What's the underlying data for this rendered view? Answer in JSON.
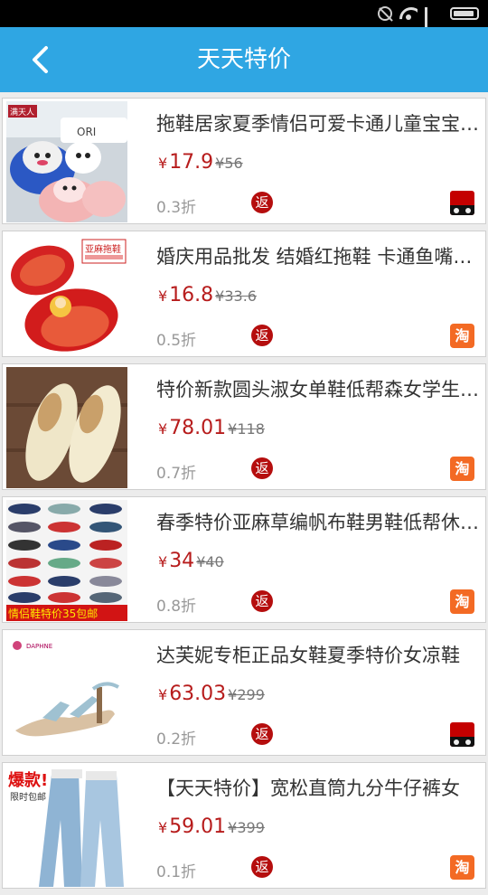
{
  "header": {
    "title": "天天特价"
  },
  "labels": {
    "yen": "¥",
    "rebate": "返",
    "taobao": "淘"
  },
  "colors": {
    "nav_blue": "#2fa6e3",
    "price_red": "#b71c1c",
    "rebate_red": "#b50e0e",
    "taobao_orange": "#f36a24",
    "tmall_red": "#c40000"
  },
  "products": [
    {
      "title": "拖鞋居家夏季情侣可爱卡通儿童宝宝凉拖鞋",
      "price": "17.9",
      "orig_price": "¥56",
      "discount": "0.3折",
      "source": "tmall-icon",
      "image": "pink-blue-slippers",
      "image_text": "满天人"
    },
    {
      "title": "婚庆用品批发 结婚红拖鞋 卡通鱼嘴拖鞋",
      "price": "16.8",
      "orig_price": "¥33.6",
      "discount": "0.5折",
      "source": "taobao-icon",
      "image": "red-wedding-slippers",
      "image_text": "亚麻拖鞋"
    },
    {
      "title": "特价新款圆头淑女单鞋低帮森女学生平底鞋",
      "price": "78.01",
      "orig_price": "¥118",
      "discount": "0.7折",
      "source": "taobao-icon",
      "image": "cream-flat-shoes",
      "image_text": ""
    },
    {
      "title": "春季特价亚麻草编帆布鞋男鞋低帮休闲鞋",
      "price": "34",
      "orig_price": "¥40",
      "discount": "0.8折",
      "source": "taobao-icon",
      "image": "canvas-espadrilles-grid",
      "image_text": "情侣鞋特价35包邮"
    },
    {
      "title": "达芙妮专柜正品女鞋夏季特价女凉鞋",
      "price": "63.03",
      "orig_price": "¥299",
      "discount": "0.2折",
      "source": "tmall-icon",
      "image": "strappy-sandal",
      "image_text": "DAPHNE"
    },
    {
      "title": "【天天特价】宽松直筒九分牛仔裤女",
      "price": "59.01",
      "orig_price": "¥399",
      "discount": "0.1折",
      "source": "taobao-icon",
      "image": "jeans-model",
      "image_text": "爆款!"
    }
  ]
}
